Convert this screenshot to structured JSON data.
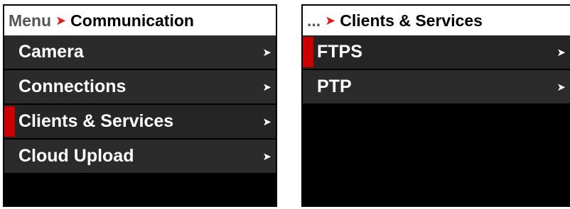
{
  "left": {
    "breadcrumb": {
      "parent": "Menu",
      "current": "Communication"
    },
    "items": [
      {
        "label": "Camera",
        "selected": false
      },
      {
        "label": "Connections",
        "selected": false
      },
      {
        "label": "Clients & Services",
        "selected": true
      },
      {
        "label": "Cloud Upload",
        "selected": false
      }
    ]
  },
  "right": {
    "breadcrumb": {
      "parent": "...",
      "current": "Clients & Services"
    },
    "items": [
      {
        "label": "FTPS",
        "selected": true
      },
      {
        "label": "PTP",
        "selected": false
      }
    ]
  },
  "icons": {
    "breadcrumb_separator": "chevron-right-icon",
    "submenu": "chevron-right-icon"
  },
  "colors": {
    "accent": "#cc0000",
    "separator": "#e11b22",
    "item_bg": "#2b2b2b",
    "panel_bg": "#000000"
  }
}
